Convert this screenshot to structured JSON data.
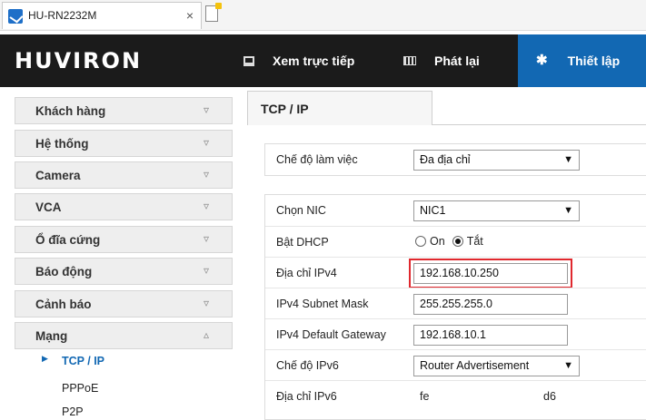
{
  "browser": {
    "tab_title": "HU-RN2232M",
    "close_glyph": "×",
    "favicon": "huviron-favicon-icon",
    "new_tab_icon": "new-tab-icon"
  },
  "header": {
    "logo": "HUVIRON",
    "nav": [
      {
        "label": "Xem trực tiếp",
        "icon": "monitor-icon"
      },
      {
        "label": "Phát lại",
        "icon": "film-icon"
      },
      {
        "label": "Thiết lập",
        "icon": "gear-icon",
        "active": true
      }
    ],
    "active_color": "#1268b3"
  },
  "sidebar": {
    "items": [
      {
        "label": "Khách hàng",
        "chevron": "▿"
      },
      {
        "label": "Hệ thống",
        "chevron": "▿"
      },
      {
        "label": "Camera",
        "chevron": "▿"
      },
      {
        "label": "VCA",
        "chevron": "▿"
      },
      {
        "label": "Ổ đĩa cứng",
        "chevron": "▿"
      },
      {
        "label": "Báo động",
        "chevron": "▿"
      },
      {
        "label": "Cảnh báo",
        "chevron": "▿"
      },
      {
        "label": "Mạng",
        "chevron": "▵",
        "expanded": true
      }
    ],
    "subitems": [
      {
        "label": "TCP / IP",
        "active": true,
        "arrow": "▶"
      },
      {
        "label": "PPPoE"
      },
      {
        "label": "P2P"
      }
    ]
  },
  "main": {
    "tab_label": "TCP / IP",
    "work_mode": {
      "label": "Chế độ làm việc",
      "value": "Đa địa chỉ"
    },
    "nic": {
      "label": "Chọn NIC",
      "value": "NIC1"
    },
    "dhcp": {
      "label": "Bật DHCP",
      "on_label": "On",
      "off_label": "Tắt",
      "selected": "off"
    },
    "ipv4": {
      "label": "Địa chỉ IPv4",
      "value": "192.168.10.250"
    },
    "subnet": {
      "label": "IPv4 Subnet Mask",
      "value": "255.255.255.0"
    },
    "gateway": {
      "label": "IPv4 Default Gateway",
      "value": "192.168.10.1"
    },
    "ipv6_mode": {
      "label": "Chế độ IPv6",
      "value": "Router Advertisement"
    },
    "ipv6_addr": {
      "label": "Địa chỉ IPv6",
      "prefix": "fe",
      "suffix": "d6"
    },
    "highlight_color": "#e0282e",
    "caret": "▼"
  }
}
